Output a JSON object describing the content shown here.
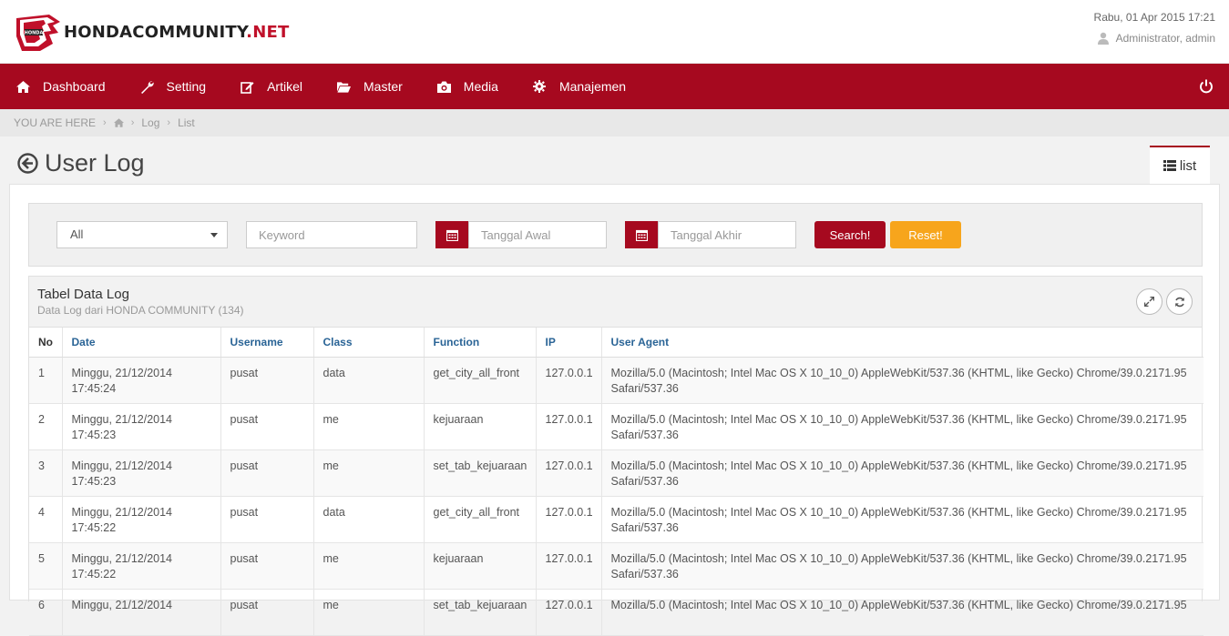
{
  "brand": {
    "name_main": "HONDACOMMUNITY",
    "name_suffix": ".NET",
    "badge_text": "HONDA"
  },
  "header": {
    "datetime": "Rabu, 01 Apr 2015 17:21",
    "user": "Administrator, admin"
  },
  "nav": [
    {
      "label": "Dashboard",
      "icon": "home-icon"
    },
    {
      "label": "Setting",
      "icon": "wrench-icon"
    },
    {
      "label": "Artikel",
      "icon": "edit-icon"
    },
    {
      "label": "Master",
      "icon": "folder-open-icon"
    },
    {
      "label": "Media",
      "icon": "camera-icon"
    },
    {
      "label": "Manajemen",
      "icon": "gear-icon"
    }
  ],
  "breadcrumb": {
    "prefix": "YOU ARE HERE",
    "items": [
      "Log",
      "List"
    ]
  },
  "page": {
    "title": "User Log",
    "tab_label": "list"
  },
  "filter": {
    "select_value": "All",
    "keyword_placeholder": "Keyword",
    "start_date_placeholder": "Tanggal Awal",
    "end_date_placeholder": "Tanggal Akhir",
    "search_label": "Search!",
    "reset_label": "Reset!"
  },
  "panel": {
    "title": "Tabel Data Log",
    "subtitle": "Data Log dari HONDA COMMUNITY (134)"
  },
  "table": {
    "columns": [
      "No",
      "Date",
      "Username",
      "Class",
      "Function",
      "IP",
      "User Agent"
    ],
    "rows": [
      {
        "no": "1",
        "date1": "Minggu, 21/12/2014",
        "date2": "17:45:24",
        "username": "pusat",
        "class": "data",
        "function": "get_city_all_front",
        "ip": "127.0.0.1",
        "ua1": "Mozilla/5.0 (Macintosh; Intel Mac OS X 10_10_0) AppleWebKit/537.36 (KHTML, like Gecko) Chrome/39.0.2171.95",
        "ua2": "Safari/537.36"
      },
      {
        "no": "2",
        "date1": "Minggu, 21/12/2014",
        "date2": "17:45:23",
        "username": "pusat",
        "class": "me",
        "function": "kejuaraan",
        "ip": "127.0.0.1",
        "ua1": "Mozilla/5.0 (Macintosh; Intel Mac OS X 10_10_0) AppleWebKit/537.36 (KHTML, like Gecko) Chrome/39.0.2171.95",
        "ua2": "Safari/537.36"
      },
      {
        "no": "3",
        "date1": "Minggu, 21/12/2014",
        "date2": "17:45:23",
        "username": "pusat",
        "class": "me",
        "function": "set_tab_kejuaraan",
        "ip": "127.0.0.1",
        "ua1": "Mozilla/5.0 (Macintosh; Intel Mac OS X 10_10_0) AppleWebKit/537.36 (KHTML, like Gecko) Chrome/39.0.2171.95",
        "ua2": "Safari/537.36"
      },
      {
        "no": "4",
        "date1": "Minggu, 21/12/2014",
        "date2": "17:45:22",
        "username": "pusat",
        "class": "data",
        "function": "get_city_all_front",
        "ip": "127.0.0.1",
        "ua1": "Mozilla/5.0 (Macintosh; Intel Mac OS X 10_10_0) AppleWebKit/537.36 (KHTML, like Gecko) Chrome/39.0.2171.95",
        "ua2": "Safari/537.36"
      },
      {
        "no": "5",
        "date1": "Minggu, 21/12/2014",
        "date2": "17:45:22",
        "username": "pusat",
        "class": "me",
        "function": "kejuaraan",
        "ip": "127.0.0.1",
        "ua1": "Mozilla/5.0 (Macintosh; Intel Mac OS X 10_10_0) AppleWebKit/537.36 (KHTML, like Gecko) Chrome/39.0.2171.95",
        "ua2": "Safari/537.36"
      },
      {
        "no": "6",
        "date1": "Minggu, 21/12/2014",
        "date2": "",
        "username": "pusat",
        "class": "me",
        "function": "set_tab_kejuaraan",
        "ip": "127.0.0.1",
        "ua1": "Mozilla/5.0 (Macintosh; Intel Mac OS X 10_10_0) AppleWebKit/537.36 (KHTML, like Gecko) Chrome/39.0.2171.95",
        "ua2": ""
      }
    ]
  },
  "colors": {
    "brand_red": "#a6091f",
    "reset_orange": "#f7a51c",
    "link_blue": "#2a6496"
  }
}
